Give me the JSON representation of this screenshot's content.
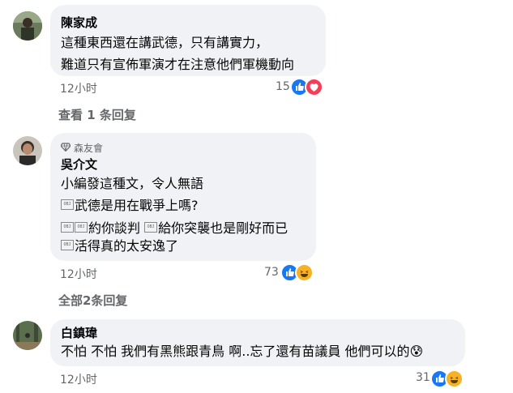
{
  "obj_placeholder": "OBJ",
  "comments": [
    {
      "author": "陳家成",
      "lines": [
        "這種東西還在講武德，只有講實力，",
        "難道只有宣佈軍演才在注意他們軍機動向"
      ],
      "time": "12小时",
      "reaction_count": "15",
      "reactions": [
        "like",
        "love"
      ],
      "replies_link": "查看 1 条回复"
    },
    {
      "badge": "森友會",
      "author": "吳介文",
      "line1": "小編發這種文，令人無語",
      "line2": "武德是用在戰爭上嗎?",
      "line3_a": "約你談判",
      "line3_b": "給你突襲也是剛好而已",
      "line4": "活得真的太安逸了",
      "time": "12小时",
      "reaction_count": "73",
      "reactions": [
        "like",
        "haha"
      ],
      "replies_link": "全部2条回复"
    },
    {
      "author": "白鎮瑋",
      "text": "不怕 不怕 我們有黑熊跟青鳥 啊..忘了還有苗議員 他們可以的",
      "emoji": "😰",
      "time": "12小时",
      "reaction_count": "31",
      "reactions": [
        "like",
        "haha"
      ]
    }
  ],
  "colors": {
    "bubble": "#f0f2f5",
    "meta_text": "#65676b",
    "like": "#1877f2",
    "love": "#f33e58",
    "haha": "#f7b125"
  }
}
